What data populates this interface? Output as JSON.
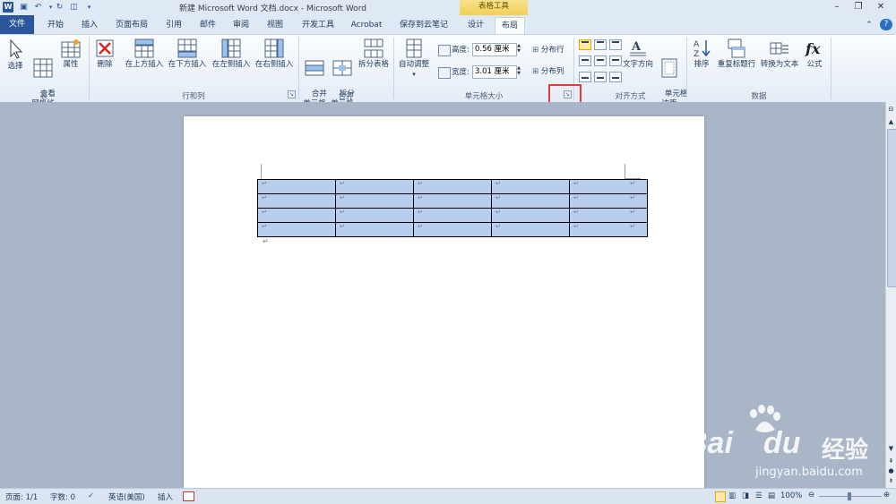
{
  "titlebar": {
    "title": "新建 Microsoft Word 文档.docx - Microsoft Word",
    "context_group": "表格工具",
    "word_logo": "W"
  },
  "tabs": {
    "file": "文件",
    "items": [
      "开始",
      "插入",
      "页面布局",
      "引用",
      "邮件",
      "审阅",
      "视图",
      "开发工具",
      "Acrobat",
      "保存到云笔记",
      "设计",
      "布局"
    ]
  },
  "ribbon": {
    "groups": {
      "table": "表",
      "rows_cols": "行和列",
      "merge": "合并",
      "cell_size": "单元格大小",
      "alignment": "对齐方式",
      "data": "数据"
    },
    "table_btns": [
      "选择",
      "查看\n网格线",
      "属性"
    ],
    "rows_btns": [
      "删除",
      "在上方插入",
      "在下方插入",
      "在左侧插入",
      "在右侧插入"
    ],
    "merge_btns": [
      "合并\n单元格",
      "拆分\n单元格",
      "拆分表格"
    ],
    "autofit": "自动调整",
    "height_label": "高度:",
    "height_value": "0.56 厘米",
    "width_label": "宽度:",
    "width_value": "3.01 厘米",
    "distribute_rows": "分布行",
    "distribute_cols": "分布列",
    "text_direction": "文字方向",
    "cell_margins": "单元格\n边距",
    "data_btns": [
      "排序",
      "重复标题行",
      "转换为文本",
      "公式"
    ]
  },
  "table": {
    "rows": 4,
    "cols": 5,
    "cell_mark": "↵"
  },
  "statusbar": {
    "page": "页面: 1/1",
    "words": "字数: 0",
    "language": "英语(美国)",
    "mode": "插入",
    "zoom": "100%"
  },
  "watermark": {
    "brand": "Bai",
    "brand2": "du",
    "chinese": "经验",
    "url": "jingyan.baidu.com"
  },
  "colors": {
    "accent": "#2b579a",
    "table_fill": "#b7cfee",
    "highlight": "#e23b3b"
  }
}
